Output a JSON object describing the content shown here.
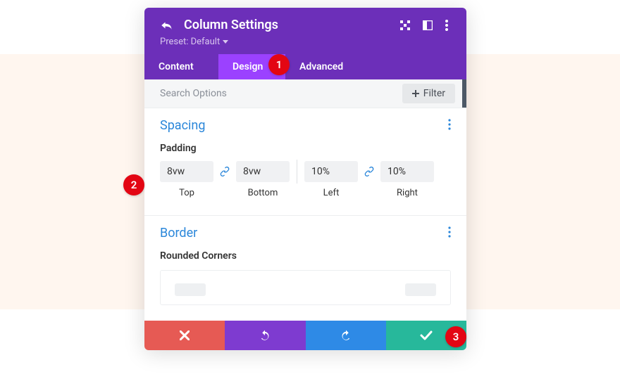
{
  "header": {
    "title": "Column Settings",
    "preset_label": "Preset: Default"
  },
  "tabs": {
    "content": "Content",
    "design": "Design",
    "advanced": "Advanced",
    "active": "design"
  },
  "search": {
    "placeholder": "Search Options",
    "filter_label": "Filter"
  },
  "spacing": {
    "title": "Spacing",
    "padding_label": "Padding",
    "top_value": "8vw",
    "bottom_value": "8vw",
    "left_value": "10%",
    "right_value": "10%",
    "top_label": "Top",
    "bottom_label": "Bottom",
    "left_label": "Left",
    "right_label": "Right"
  },
  "border": {
    "title": "Border",
    "rounded_label": "Rounded Corners"
  },
  "badges": {
    "b1": "1",
    "b2": "2",
    "b3": "3"
  },
  "colors": {
    "header": "#6c2fb9",
    "tab_active": "#9b41ff",
    "accent": "#2b87da",
    "cancel": "#e65a54",
    "undo": "#7e3bd0",
    "redo": "#2e8ae6",
    "save": "#27b89b",
    "badge": "#e30613"
  }
}
